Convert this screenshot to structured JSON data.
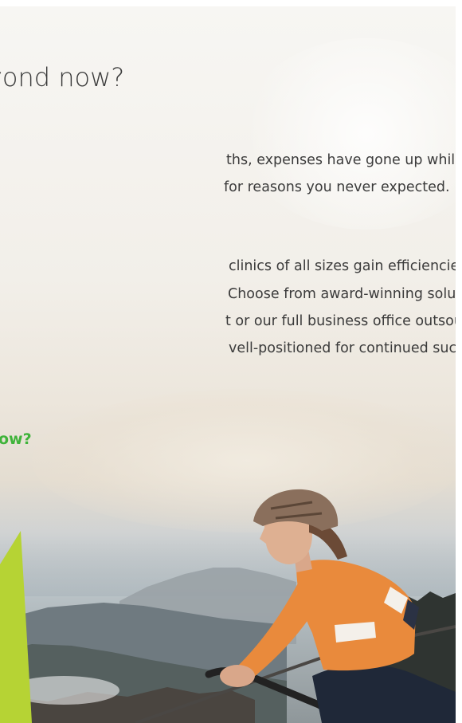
{
  "hero": {
    "headline": "u got beyond now?",
    "paragraph_1": {
      "line_1": "ths, expenses have gone up while",
      "line_2": "for reasons you never expected."
    },
    "paragraph_2": {
      "line_1": "clinics of all sizes gain efficiencies and",
      "line_2": "Choose from award-winning solutions,",
      "line_3": "t or our full business office outsourcing",
      "line_4": "vell-positioned for continued success"
    },
    "cta_label": "ow?"
  },
  "colors": {
    "cta_green": "#3fb33a",
    "accent_lime": "#b6d334",
    "jersey_orange": "#e98a3c",
    "helmet_bronze": "#8a6f5c",
    "text_dark": "#3b3b3b"
  },
  "image": {
    "subject": "cyclist-on-mountain-overlook",
    "icons": [
      "lime-accent-shape"
    ]
  }
}
